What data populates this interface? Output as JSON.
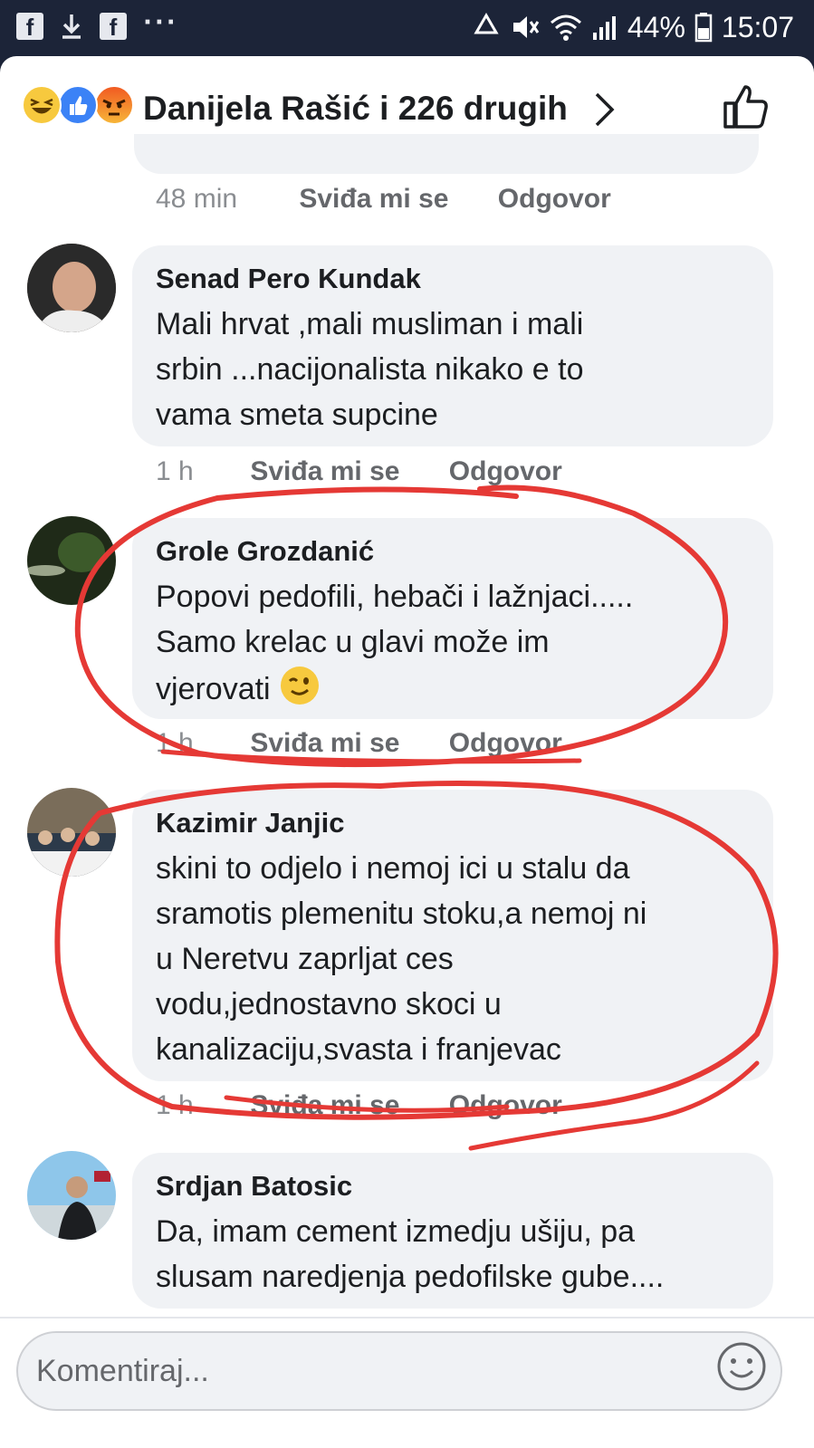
{
  "status_bar": {
    "left_icons": [
      "facebook-icon",
      "download-icon",
      "facebook-icon",
      "more-icon"
    ],
    "right_icons": [
      "recycle-icon",
      "mute-icon",
      "wifi-icon",
      "signal-icon",
      "battery-icon"
    ],
    "fb_glyph": "f",
    "dots": "···",
    "battery": "44%",
    "time": "15:07"
  },
  "header": {
    "reaction_icons": [
      "haha-icon",
      "like-icon",
      "angry-icon"
    ],
    "title": "Danijela Rašić i 226 drugih"
  },
  "feed": {
    "prev_comment_meta": {
      "time": "48 min",
      "like": "Sviđa mi se",
      "reply": "Odgovor"
    },
    "comments": [
      {
        "author": "Senad Pero Kundak",
        "lines": [
          "Mali hrvat ,mali musliman i mali",
          "srbin ...nacijonalista nikako e to",
          "vama smeta supcine"
        ],
        "time": "1 h",
        "like": "Sviđa mi se",
        "reply": "Odgovor"
      },
      {
        "author": "Grole Grozdanić",
        "lines": [
          "Popovi pedofili, hebači i lažnjaci.....",
          "Samo krelac u glavi može im",
          "vjerovati"
        ],
        "emoji": "wink-icon",
        "time": "1 h",
        "like": "Sviđa mi se",
        "reply": "Odgovor"
      },
      {
        "author": "Kazimir Janjic",
        "lines": [
          "skini to odjelo i nemoj ici u stalu da",
          "sramotis plemenitu stoku,a nemoj ni",
          "u Neretvu zaprljat ces",
          "vodu,jednostavno skoci u",
          "kanalizaciju,svasta i franjevac"
        ],
        "time": "1 h",
        "like": "Sviđa mi se",
        "reply": "Odgovor"
      },
      {
        "author": "Srdjan Batosic",
        "lines": [
          "Da, imam cement izmedju ušiju, pa",
          "slusam naredjenja pedofilske gube...."
        ]
      }
    ]
  },
  "annotation_color": "#e53935",
  "composer": {
    "placeholder": "Komentiraj..."
  }
}
